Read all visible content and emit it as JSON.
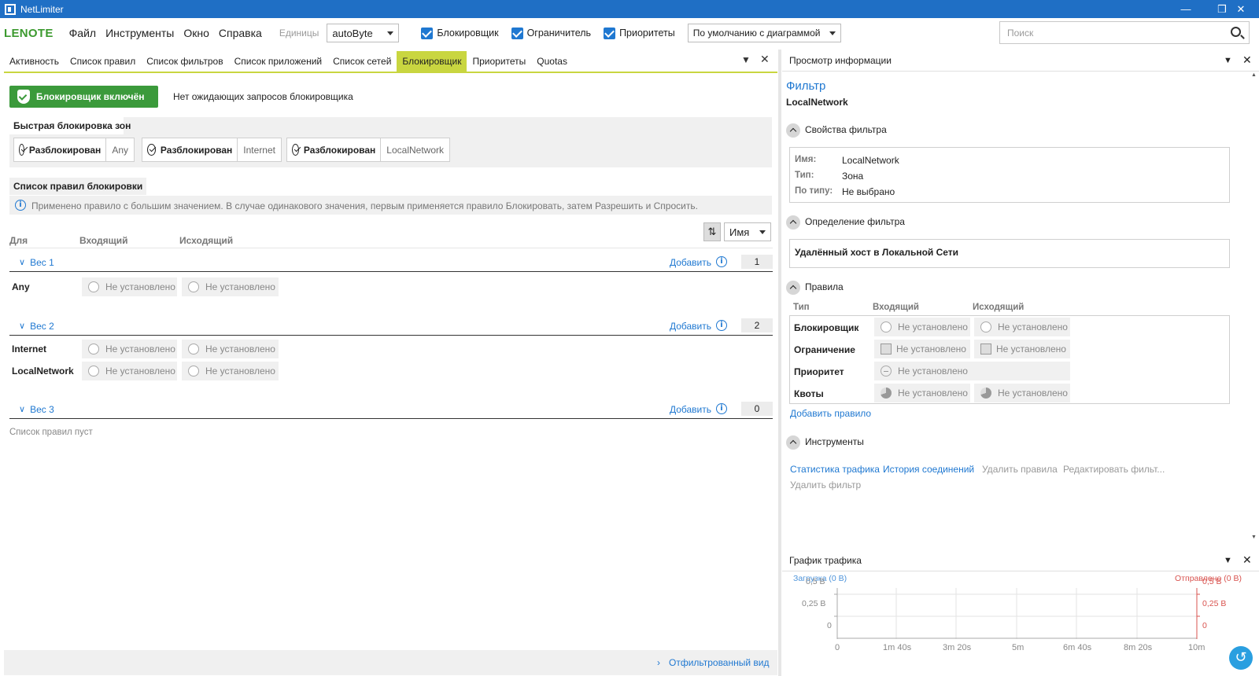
{
  "window": {
    "title": "NetLimiter",
    "min": "—",
    "max": "❒",
    "close": "✕"
  },
  "menubar": {
    "brand": "LENOTE",
    "items": [
      "Файл",
      "Инструменты",
      "Окно",
      "Справка"
    ],
    "units_label": "Единицы",
    "units_value": "autoByte",
    "checks": [
      "Блокировщик",
      "Ограничитель",
      "Приоритеты"
    ],
    "view_value": "По умолчанию с диаграммой",
    "search_placeholder": "Поиск"
  },
  "left": {
    "tabs": [
      "Активность",
      "Список правил",
      "Список фильтров",
      "Список приложений",
      "Список сетей",
      "Блокировщик",
      "Приоритеты",
      "Quotas"
    ],
    "active_tab": "Блокировщик",
    "blocker_button": "Блокировщик включён",
    "pending_text": "Нет ожидающих запросов блокировщика",
    "quick_zone_title": "Быстрая блокировка зон",
    "zones": [
      {
        "state": "Разблокирован",
        "zone": "Any"
      },
      {
        "state": "Разблокирован",
        "zone": "Internet"
      },
      {
        "state": "Разблокирован",
        "zone": "LocalNetwork"
      }
    ],
    "rules_title": "Список правил блокировки",
    "rules_info": "Применено правило с большим значением. В случае одинакового значения, первым применяется правило Блокировать, затем Разрешить и Спросить.",
    "columns": [
      "Для",
      "Входящий",
      "Исходящий"
    ],
    "sort_value": "Имя",
    "weights": [
      {
        "label": "Вес 1",
        "add": "Добавить",
        "count": "1",
        "rows": [
          {
            "name": "Any",
            "in": "Не установлено",
            "out": "Не установлено"
          }
        ]
      },
      {
        "label": "Вес 2",
        "add": "Добавить",
        "count": "2",
        "rows": [
          {
            "name": "Internet",
            "in": "Не установлено",
            "out": "Не установлено"
          },
          {
            "name": "LocalNetwork",
            "in": "Не установлено",
            "out": "Не установлено"
          }
        ]
      },
      {
        "label": "Вес 3",
        "add": "Добавить",
        "count": "0",
        "rows": []
      }
    ],
    "empty_text": "Список правил пуст",
    "filtered_view": "Отфильтрованный вид"
  },
  "info": {
    "panel_title": "Просмотр информации",
    "filter_heading": "Фильтр",
    "filter_name": "LocalNetwork",
    "props_title": "Свойства фильтра",
    "props": [
      {
        "label": "Имя:",
        "value": "LocalNetwork"
      },
      {
        "label": "Тип:",
        "value": "Зона"
      },
      {
        "label": "По типу:",
        "value": "Не выбрано"
      }
    ],
    "definition_title": "Определение фильтра",
    "definition_value": "Удалённый хост в Локальной Сети",
    "rules_title": "Правила",
    "rules_columns": [
      "Тип",
      "Входящий",
      "Исходящий"
    ],
    "rules": [
      {
        "type": "Блокировщик",
        "in": "Не установлено",
        "out": "Не установлено"
      },
      {
        "type": "Ограничение",
        "in": "Не установлено",
        "out": "Не установлено"
      },
      {
        "type": "Приоритет",
        "in": "Не установлено",
        "out": ""
      },
      {
        "type": "Квоты",
        "in": "Не установлено",
        "out": "Не установлено"
      }
    ],
    "add_rule": "Добавить правило",
    "tools_title": "Инструменты",
    "tools": [
      "Статистика трафика",
      "История соединений",
      "Удалить правила",
      "Редактировать фильт..."
    ],
    "tools2": [
      "Удалить фильтр"
    ]
  },
  "graph": {
    "panel_title": "График трафика",
    "download_label": "Загрузка (0 B)",
    "upload_label": "Отправлено (0 B)",
    "y_ticks": [
      "0,5 B",
      "0,25 B",
      "0"
    ],
    "x_ticks": [
      "0",
      "1m 40s",
      "3m 20s",
      "5m",
      "6m 40s",
      "8m 20s",
      "10m"
    ]
  },
  "colors": {
    "titlebar": "#1f6fc5",
    "accent": "#1f78d1",
    "brand": "#3c9a2f",
    "active_tab": "#c9d640",
    "upload": "#d9534f"
  }
}
